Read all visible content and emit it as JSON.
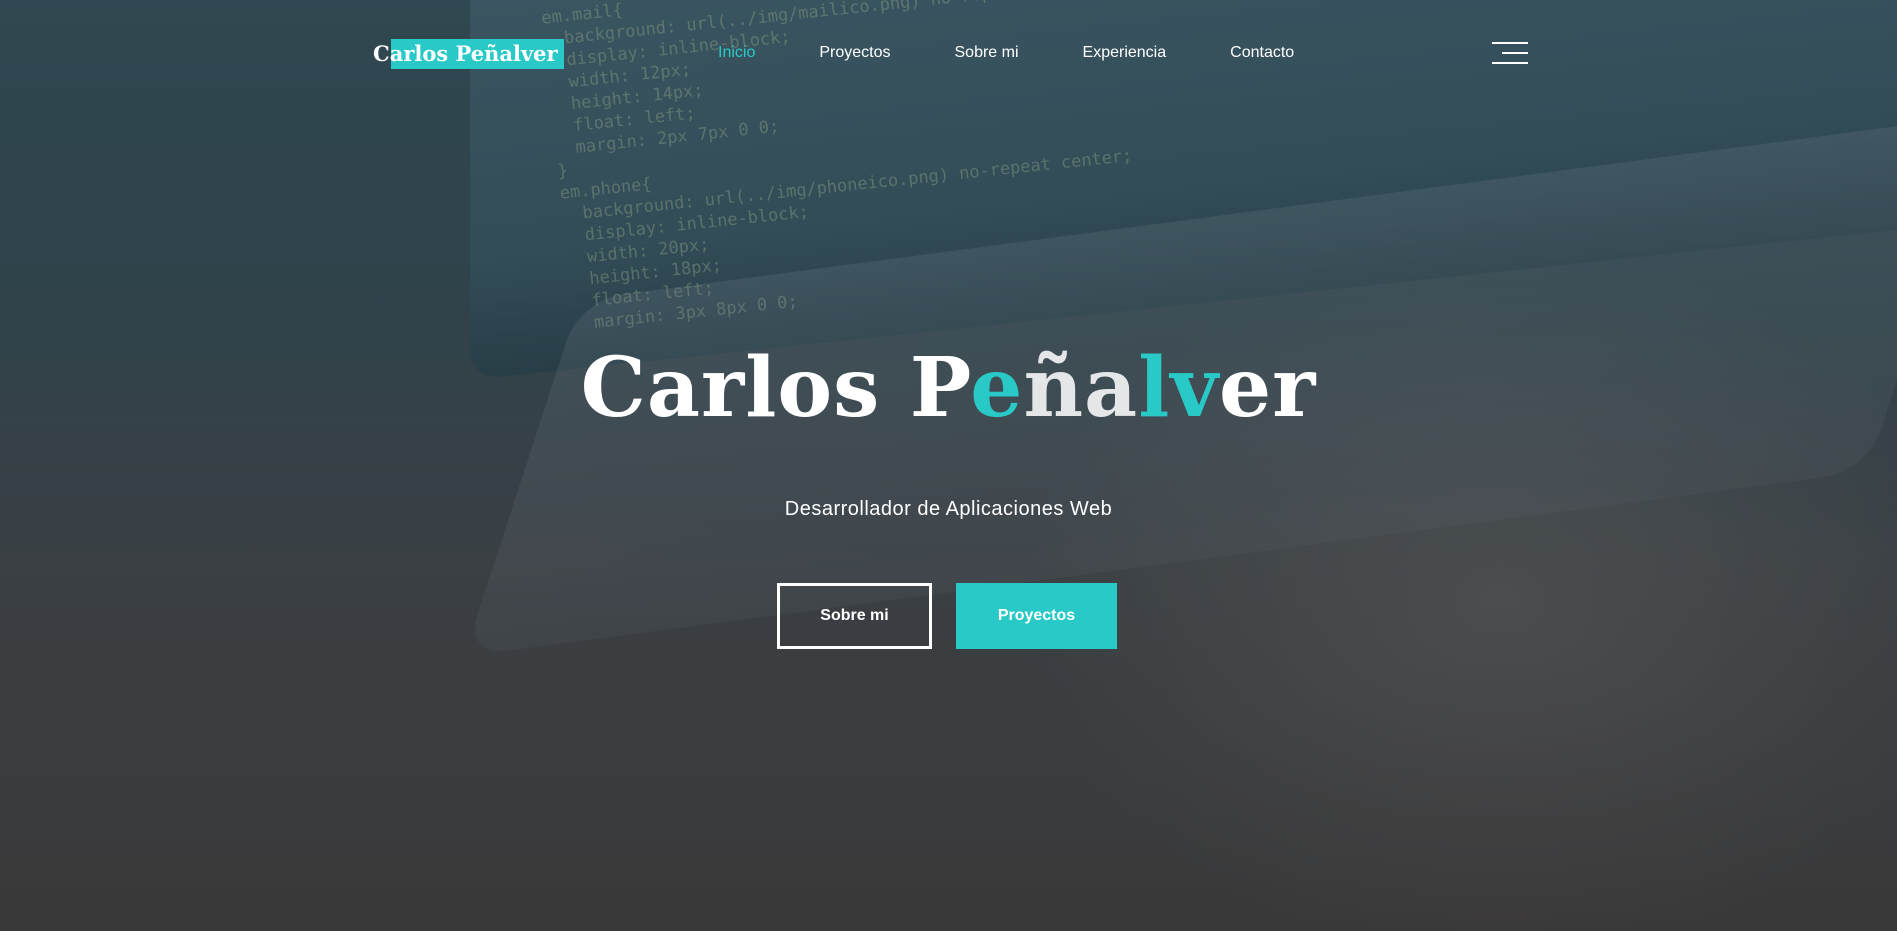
{
  "brand": {
    "logo_text": "Carlos Peñalver",
    "accent_color": "#28c9c7"
  },
  "nav": {
    "items": [
      {
        "label": "Inicio",
        "active": true
      },
      {
        "label": "Proyectos",
        "active": false
      },
      {
        "label": "Sobre mi",
        "active": false
      },
      {
        "label": "Experiencia",
        "active": false
      },
      {
        "label": "Contacto",
        "active": false
      }
    ],
    "menu_icon": "hamburger-icon"
  },
  "hero": {
    "title_parts": [
      {
        "text": "Carlos P",
        "color": "#ffffff"
      },
      {
        "text": "e",
        "color": "#28c9c7"
      },
      {
        "text": "ña",
        "color": "#e4e6e8"
      },
      {
        "text": "lv",
        "color": "#28c9c7"
      },
      {
        "text": "er",
        "color": "#ffffff"
      }
    ],
    "subtitle": "Desarrollador de Aplicaciones Web",
    "buttons": {
      "secondary_label": "Sobre mi",
      "primary_label": "Proyectos"
    }
  }
}
